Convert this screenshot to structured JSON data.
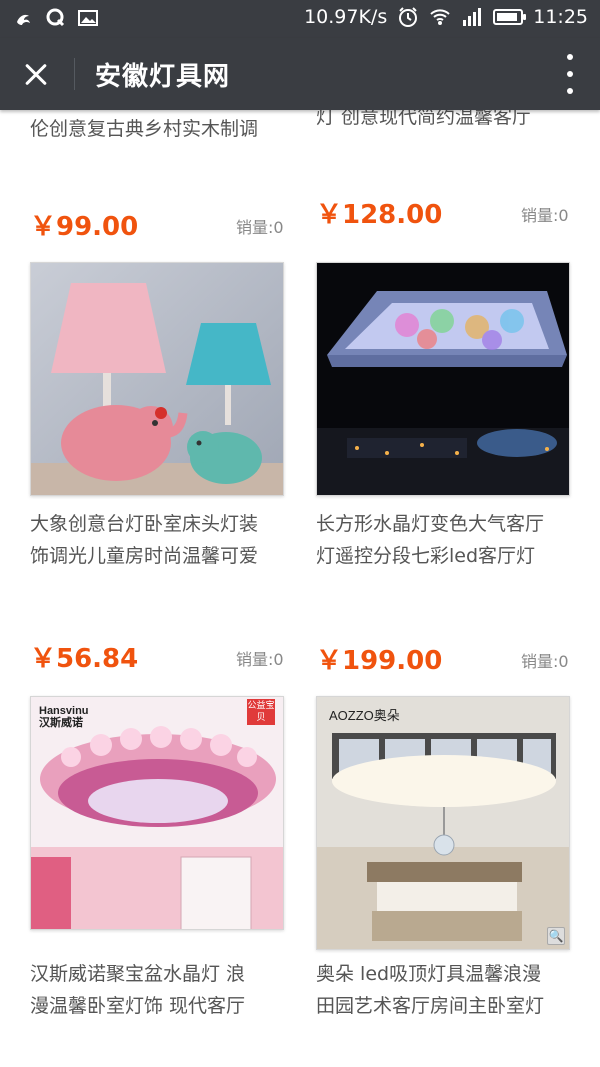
{
  "status_bar": {
    "speed": "10.97K/s",
    "time": "11:25",
    "left_icons": [
      "uc-browser-icon",
      "qq-icon",
      "image-icon"
    ],
    "right_icons": [
      "alarm-icon",
      "wifi-icon",
      "signal-icon",
      "battery-icon"
    ]
  },
  "header": {
    "title": "安徽灯具网"
  },
  "top_partial": {
    "left_text": "伦创意复古典乡村实木制调",
    "right_text": "灯 创意现代简约温馨客厅"
  },
  "rows": [
    {
      "left": {
        "price": "￥99.00",
        "sales": "销量:0"
      },
      "right": {
        "price": "￥128.00",
        "sales": "销量:0"
      }
    },
    {
      "left": {
        "name_line1": "大象创意台灯卧室床头灯装",
        "name_line2": "饰调光儿童房时尚温馨可爱",
        "price": "￥56.84",
        "sales": "销量:0"
      },
      "right": {
        "name_line1": "长方形水晶灯变色大气客厅",
        "name_line2": "灯遥控分段七彩led客厅灯",
        "price": "￥199.00",
        "sales": "销量:0"
      }
    },
    {
      "left": {
        "name_line1": "汉斯威诺聚宝盆水晶灯 浪",
        "name_line2": "漫温馨卧室灯饰 现代客厅",
        "brand": "Hansvinu",
        "brand_cn": "汉斯威诺",
        "tag": "公益宝贝"
      },
      "right": {
        "name_line1": "奥朵 led吸顶灯具温馨浪漫",
        "name_line2": "田园艺术客厅房间主卧室灯",
        "brand": "AOZZO奥朵"
      }
    }
  ],
  "colors": {
    "bar": "#3a3d42",
    "price": "#f0530e"
  }
}
